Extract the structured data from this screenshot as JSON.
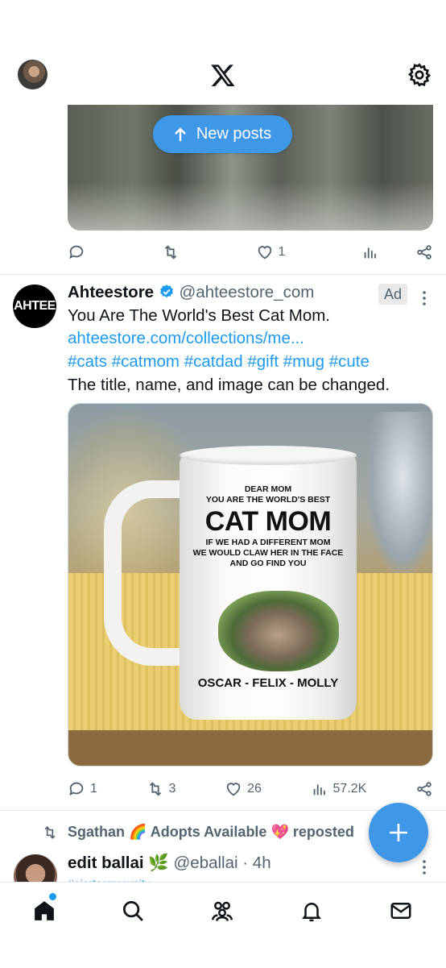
{
  "header": {
    "avatar_icon": "user-avatar",
    "logo_icon": "x-logo-icon",
    "settings_icon": "gear-icon"
  },
  "new_posts": {
    "label": "New posts",
    "icon": "arrow-up-icon"
  },
  "tweet1": {
    "reply_count": "",
    "repost_count": "",
    "like_count": "1",
    "views_count": ""
  },
  "ad_tweet": {
    "avatar_text": "AHTEE",
    "name": "Ahteestore",
    "verified": true,
    "handle": "@ahteestore_com",
    "ad_badge": "Ad",
    "text_line1": "You Are The World's Best Cat Mom.",
    "link": "ahteestore.com/collections/me...",
    "hashtags": "#cats #catmom #catdad #gift #mug #cute",
    "text_line3": "The title, name, and image can be changed.",
    "image": {
      "mug_line1": "DEAR MOM",
      "mug_line2": "YOU ARE THE WORLD'S BEST",
      "mug_big": "CAT MOM",
      "mug_line3": "IF WE HAD A DIFFERENT MOM",
      "mug_line4": "WE WOULD CLAW HER IN THE FACE",
      "mug_line5": "AND GO FIND YOU",
      "mug_names": "OSCAR - FELIX - MOLLY"
    },
    "reply_count": "1",
    "repost_count": "3",
    "like_count": "26",
    "views_count": "57.2K"
  },
  "repost_banner": {
    "text": "Sgathan 🌈 Adopts Available 💖 reposted"
  },
  "next_tweet": {
    "name": "edit ballai 🌿",
    "handle": "@eballai",
    "time": "· 4h",
    "link_fragment": "#aiartcommunity"
  },
  "fab": {
    "icon": "plus-icon"
  },
  "bottom_nav": {
    "items": [
      "home-icon",
      "search-icon",
      "communities-icon",
      "notifications-icon",
      "messages-icon"
    ]
  },
  "colors": {
    "accent": "#1d9bf0",
    "button": "#3f97e8",
    "muted": "#536471"
  }
}
